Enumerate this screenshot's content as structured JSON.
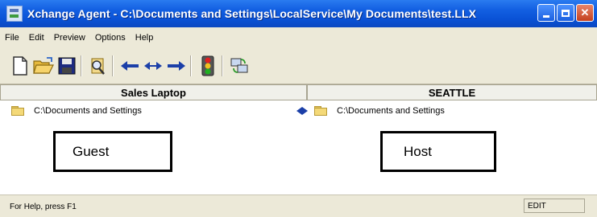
{
  "window": {
    "title": "Xchange Agent - C:\\Documents and Settings\\LocalService\\My Documents\\test.LLX"
  },
  "menu": [
    "File",
    "Edit",
    "Preview",
    "Options",
    "Help"
  ],
  "toolbar": {
    "icons": [
      "new-file-icon",
      "open-folder-icon",
      "save-icon",
      "search-icon",
      "arrow-left-icon",
      "sync-both-icon",
      "arrow-right-icon",
      "traffic-light-icon",
      "network-icon"
    ]
  },
  "panes": {
    "left": {
      "header": "Sales Laptop",
      "folder_path": "C:\\Documents and Settings"
    },
    "right": {
      "header": "SEATTLE",
      "folder_path": "C:\\Documents and Settings"
    }
  },
  "callouts": {
    "guest": "Guest",
    "host": "Host"
  },
  "status": {
    "help_text": "For Help, press F1",
    "mode": "EDIT"
  },
  "colors": {
    "titlebar": "#0a52d6",
    "arrow_blue": "#1b3fa8",
    "folder_yellow": "#f4d978"
  }
}
